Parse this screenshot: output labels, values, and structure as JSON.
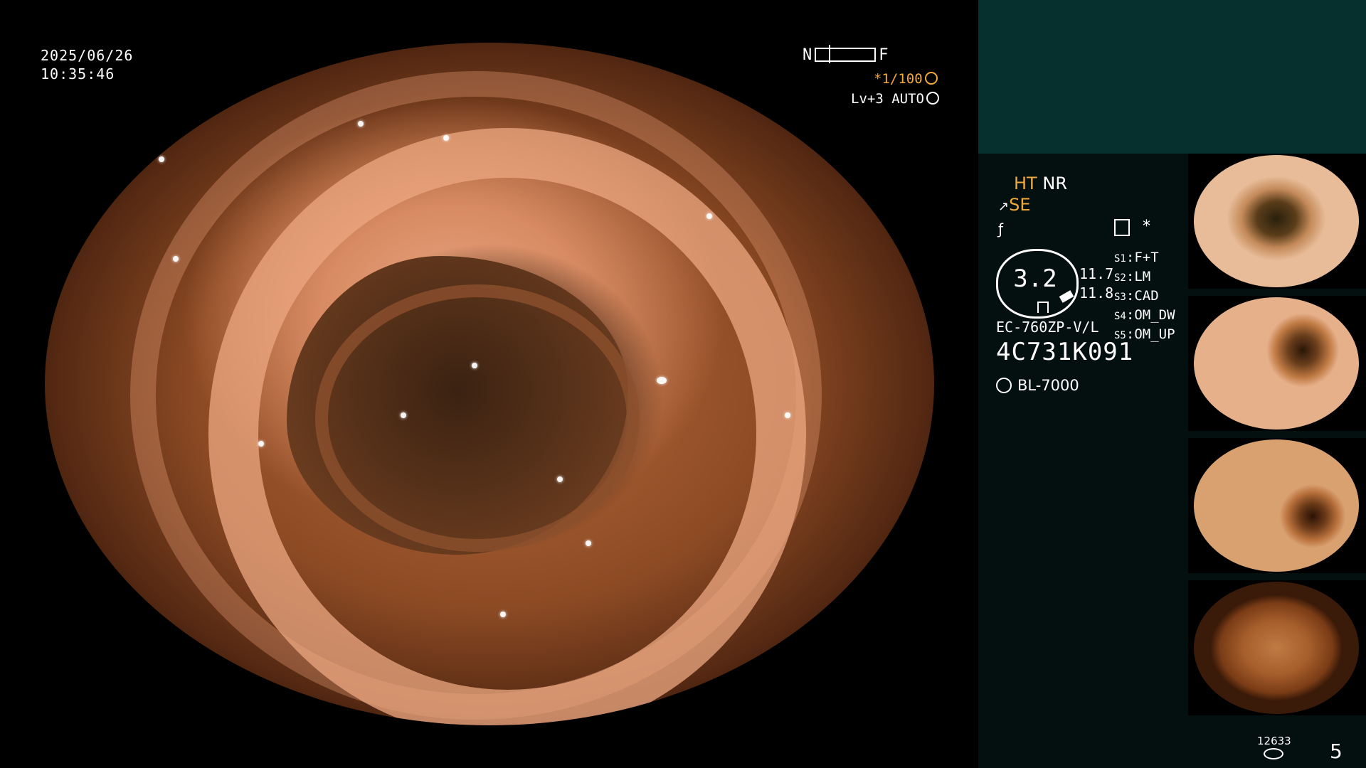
{
  "overlay": {
    "date": "2025/06/26",
    "time": "10:35:46",
    "near_label": "N",
    "far_label": "F",
    "shutter": "*1/100",
    "level": "Lv+3 AUTO"
  },
  "panel": {
    "mode_ht": "HT",
    "mode_nr": "NR",
    "mode_se": "SE",
    "gauge_value": "3.2",
    "value_top": "11.7",
    "value_bottom": "11.8",
    "scope_model": "EC-760ZP-V/L",
    "serial": "4C731K091",
    "light_source": "BL-7000",
    "star": "*",
    "switches": [
      {
        "label": "S1",
        "value": "F+T"
      },
      {
        "label": "S2",
        "value": "LM"
      },
      {
        "label": "S3",
        "value": "CAD"
      },
      {
        "label": "S4",
        "value": "OM_DW"
      },
      {
        "label": "S5",
        "value": "OM_UP"
      }
    ]
  },
  "footer": {
    "storage_count": "12633",
    "page_number": "5"
  },
  "colors": {
    "accent": "#f2a93b",
    "panel_bg": "#04100f",
    "panel_top": "#06302e"
  }
}
